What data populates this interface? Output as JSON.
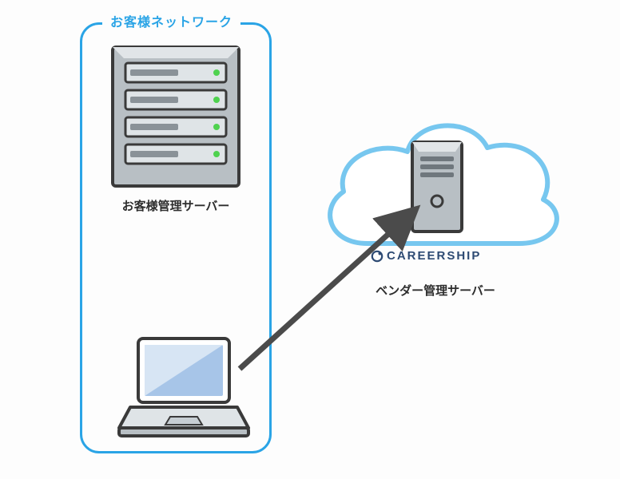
{
  "network": {
    "title": "お客様ネットワーク"
  },
  "labels": {
    "customer_server": "お客様管理サーバー",
    "vendor_server": "ベンダー管理サーバー"
  },
  "brand": {
    "name": "CAREERSHIP",
    "icon": "circle-c-icon"
  },
  "icons": {
    "server_rack": "server-rack-icon",
    "cloud": "cloud-icon",
    "server_tower": "server-tower-icon",
    "laptop": "laptop-icon",
    "arrow": "arrow-icon"
  },
  "colors": {
    "accent": "#2aa4e6",
    "stroke": "#3a3a3a",
    "server_body": "#b8bfc4",
    "server_dark": "#8a9298",
    "led": "#4fd24f",
    "screen": "#a7c5e8",
    "brand": "#2d4a73"
  }
}
